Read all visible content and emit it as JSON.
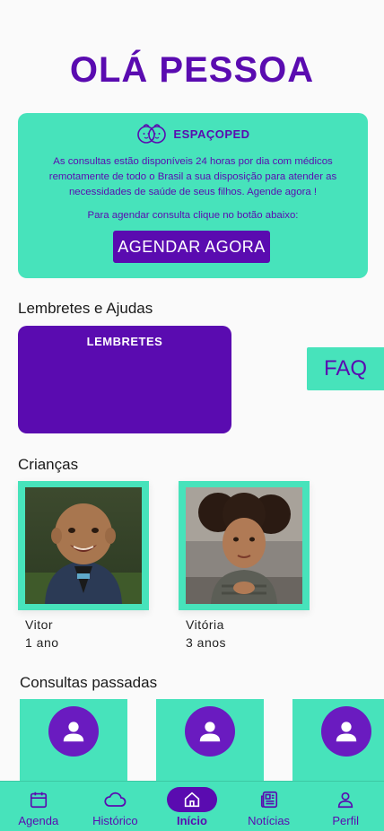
{
  "greeting": "OLÁ PESSOA",
  "promo": {
    "brand": "ESPAÇOPED",
    "text": "As consultas estão disponíveis 24 horas por dia com médicos remotamente de todo o Brasil a sua disposição para atender as necessidades de saúde de seus filhos. Agende agora !",
    "hint": "Para agendar consulta clique no botão abaixo:",
    "button": "AGENDAR AGORA"
  },
  "reminders": {
    "title": "Lembretes e Ajudas",
    "card_label": "LEMBRETES",
    "faq": "FAQ"
  },
  "children": {
    "title": "Crianças",
    "items": [
      {
        "name": "Vitor",
        "age": "1 ano"
      },
      {
        "name": "Vitória",
        "age": "3 anos"
      }
    ]
  },
  "past": {
    "title": "Consultas passadas"
  },
  "nav": {
    "items": [
      {
        "label": "Agenda",
        "icon": "calendar-icon"
      },
      {
        "label": "Histórico",
        "icon": "cloud-icon"
      },
      {
        "label": "Início",
        "icon": "home-icon"
      },
      {
        "label": "Notícias",
        "icon": "news-icon"
      },
      {
        "label": "Perfil",
        "icon": "person-icon"
      }
    ],
    "active": "Início"
  },
  "colors": {
    "primary": "#5a0bb0",
    "accent": "#47e3bb",
    "background": "#fafafa"
  }
}
